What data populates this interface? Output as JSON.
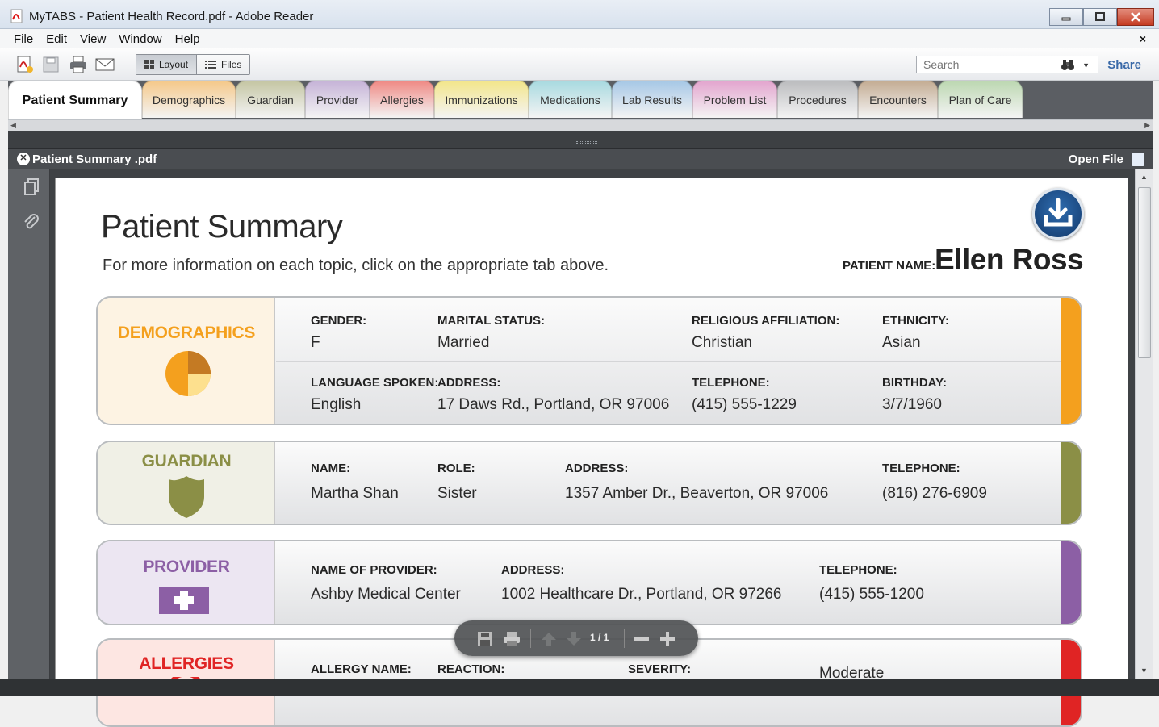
{
  "window": {
    "title": "MyTABS - Patient Health Record.pdf - Adobe Reader",
    "icon": "pdf-icon"
  },
  "menu": {
    "items": [
      "File",
      "Edit",
      "View",
      "Window",
      "Help"
    ],
    "close": "×"
  },
  "toolbar": {
    "icons": [
      "create-pdf-icon",
      "save-icon",
      "print-icon",
      "email-icon"
    ],
    "layout_label": "Layout",
    "files_label": "Files",
    "search_placeholder": "Search",
    "share_label": "Share"
  },
  "tabs": [
    {
      "label": "Patient Summary",
      "color": "#ffffff",
      "active": true
    },
    {
      "label": "Demographics",
      "color": "#f5c98b"
    },
    {
      "label": "Guardian",
      "color": "#c5c6a4"
    },
    {
      "label": "Provider",
      "color": "#c6b4d8"
    },
    {
      "label": "Allergies",
      "color": "#ef8b86"
    },
    {
      "label": "Immunizations",
      "color": "#f3e68c"
    },
    {
      "label": "Medications",
      "color": "#a9dae0"
    },
    {
      "label": "Lab Results",
      "color": "#a7c8e6"
    },
    {
      "label": "Problem List",
      "color": "#e3a6cf"
    },
    {
      "label": "Procedures",
      "color": "#bcbdbf"
    },
    {
      "label": "Encounters",
      "color": "#c4ad94"
    },
    {
      "label": "Plan of Care",
      "color": "#bdd8b2"
    }
  ],
  "docbar": {
    "filename": "Patient Summary .pdf",
    "open_file": "Open File"
  },
  "page": {
    "title": "Patient Summary",
    "subtitle": "For more information on each topic, click on the appropriate tab above.",
    "patient_name_label": "PATIENT NAME:",
    "patient_name": "Ellen Ross"
  },
  "demographics": {
    "heading": "DEMOGRAPHICS",
    "color": "#f4a01e",
    "gender_label": "GENDER:",
    "gender": "F",
    "marital_label": "MARITAL STATUS:",
    "marital": "Married",
    "religion_label": "RELIGIOUS AFFILIATION:",
    "religion": "Christian",
    "ethnicity_label": "ETHNICITY:",
    "ethnicity": "Asian",
    "language_label": "LANGUAGE SPOKEN:",
    "language": "English",
    "address_label": "ADDRESS:",
    "address": "17 Daws Rd., Portland, OR 97006",
    "phone_label": "TELEPHONE:",
    "phone": "(415) 555-1229",
    "birthday_label": "BIRTHDAY:",
    "birthday": "3/7/1960"
  },
  "guardian": {
    "heading": "GUARDIAN",
    "color": "#8b8f46",
    "name_label": "NAME:",
    "name": "Martha Shan",
    "role_label": "ROLE:",
    "role": "Sister",
    "address_label": "ADDRESS:",
    "address": "1357 Amber Dr., Beaverton, OR 97006",
    "phone_label": "TELEPHONE:",
    "phone": "(816) 276-6909"
  },
  "provider": {
    "heading": "PROVIDER",
    "color": "#8c5fa5",
    "name_label": "NAME OF PROVIDER:",
    "name": "Ashby Medical Center",
    "address_label": "ADDRESS:",
    "address": "1002 Healthcare Dr., Portland, OR 97266",
    "phone_label": "TELEPHONE:",
    "phone": "(415) 555-1200"
  },
  "allergies": {
    "heading": "ALLERGIES",
    "color": "#e02424",
    "allergy_label": "ALLERGY NAME:",
    "reaction_label": "REACTION:",
    "severity_label": "SEVERITY:",
    "severity": "Moderate"
  },
  "page_control": {
    "page_indicator": "1 / 1"
  }
}
